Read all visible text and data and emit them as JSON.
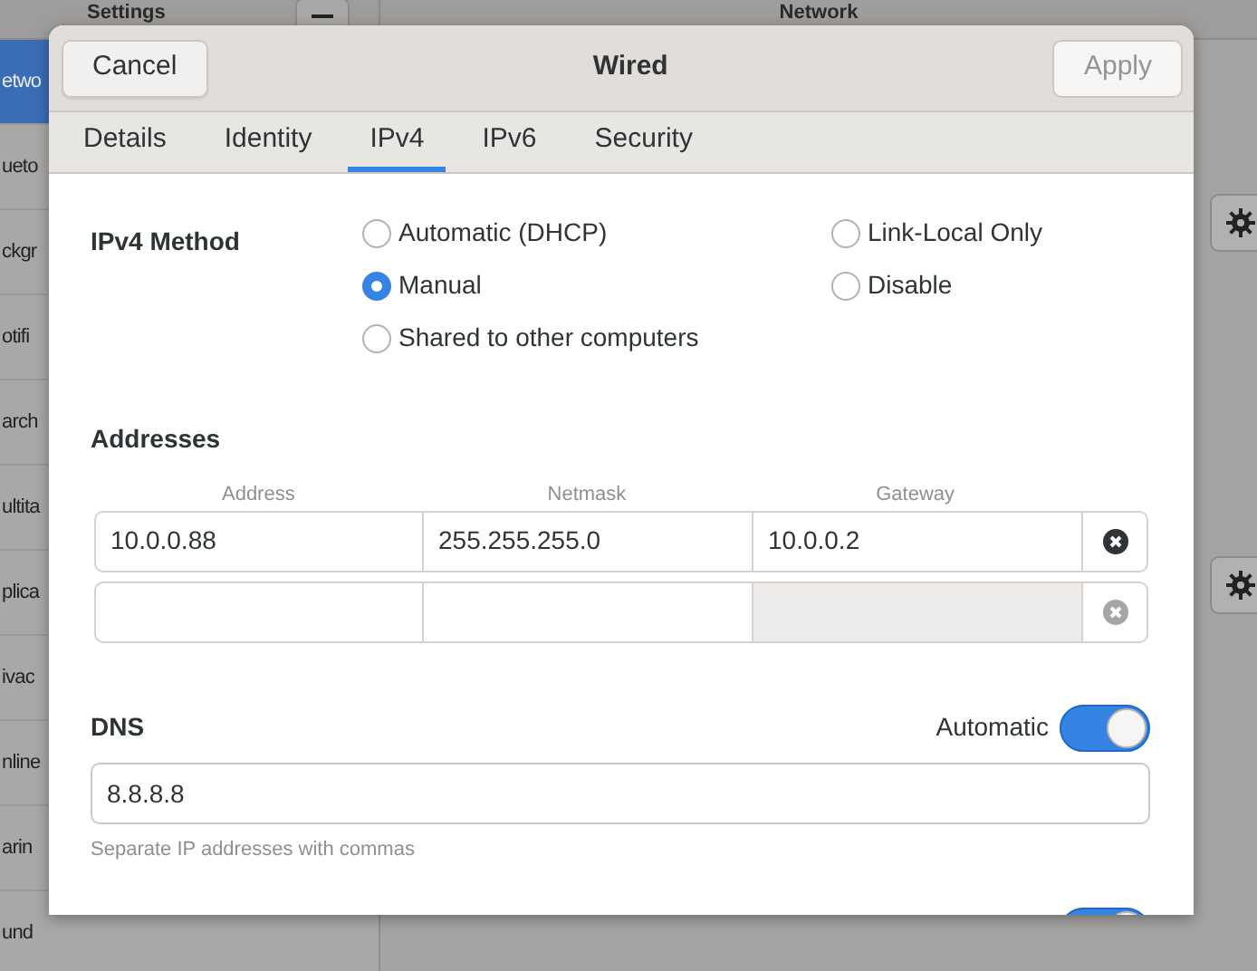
{
  "settings_window": {
    "title": "Settings",
    "page_title": "Network"
  },
  "sidebar": {
    "items": [
      {
        "label": "etwo",
        "selected": true
      },
      {
        "label": "ueto",
        "selected": false
      },
      {
        "label": "ckgr",
        "selected": false
      },
      {
        "label": "otifi",
        "selected": false
      },
      {
        "label": "arch",
        "selected": false
      },
      {
        "label": "ultita",
        "selected": false
      },
      {
        "label": "plica",
        "selected": false
      },
      {
        "label": "ivac",
        "selected": false
      },
      {
        "label": "nline",
        "selected": false
      },
      {
        "label": "arin",
        "selected": false
      },
      {
        "label": "und",
        "selected": false
      }
    ]
  },
  "dialog": {
    "title": "Wired",
    "cancel": "Cancel",
    "apply": {
      "label": "Apply",
      "disabled": true
    },
    "tabs": [
      {
        "label": "Details",
        "selected": false
      },
      {
        "label": "Identity",
        "selected": false
      },
      {
        "label": "IPv4",
        "selected": true
      },
      {
        "label": "IPv6",
        "selected": false
      },
      {
        "label": "Security",
        "selected": false
      }
    ],
    "ipv4_method": {
      "label": "IPv4 Method",
      "options": [
        {
          "label": "Automatic (DHCP)",
          "selected": false
        },
        {
          "label": "Link-Local Only",
          "selected": false
        },
        {
          "label": "Manual",
          "selected": true
        },
        {
          "label": "Disable",
          "selected": false
        },
        {
          "label": "Shared to other computers",
          "selected": false
        }
      ]
    },
    "addresses": {
      "title": "Addresses",
      "columns": [
        "Address",
        "Netmask",
        "Gateway"
      ],
      "rows": [
        {
          "address": "10.0.0.88",
          "netmask": "255.255.255.0",
          "gateway": "10.0.0.2",
          "gateway_disabled": false,
          "delete_disabled": false
        },
        {
          "gateway_disabled": true,
          "delete_disabled": true
        }
      ]
    },
    "dns": {
      "title": "DNS",
      "automatic_label": "Automatic",
      "automatic_on": true,
      "value": "8.8.8.8",
      "hint": "Separate IP addresses with commas"
    },
    "routes_switch_on": true
  }
}
